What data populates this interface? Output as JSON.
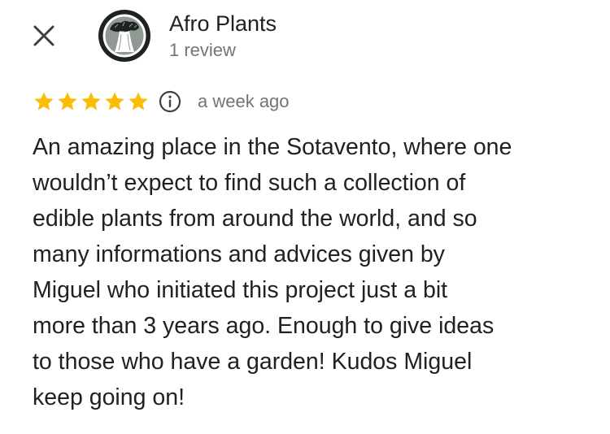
{
  "header": {
    "close_icon": "close-icon",
    "avatar_icon": "baobab-tree-logo"
  },
  "reviewer": {
    "name": "Afro Plants",
    "review_count": "1 review"
  },
  "review": {
    "rating": 5,
    "rating_max": 5,
    "star_color": "#FBBC04",
    "info_icon": "info-icon",
    "timestamp": "a week ago",
    "lines": [
      "An amazing place in the Sotavento, where one",
      "wouldn’t expect to find such a collection of",
      "edible plants from around the world, and so",
      "many informations and advices given by",
      "Miguel who initiated this project just a bit",
      "more than 3 years ago. Enough to give ideas",
      "to those who have a garden! Kudos Miguel",
      "keep going on!"
    ]
  },
  "colors": {
    "text_primary": "#202124",
    "text_secondary": "#70757a",
    "avatar_bg": "#202124",
    "avatar_inner": "#8f9a92"
  }
}
